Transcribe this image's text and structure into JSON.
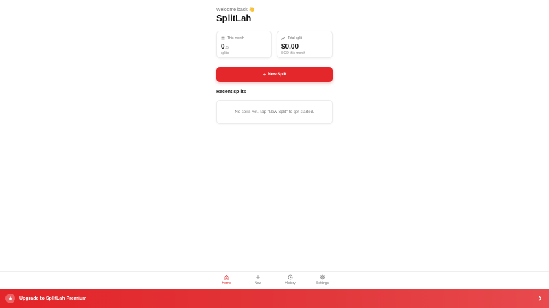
{
  "header": {
    "welcome": "Welcome back 👋",
    "title": "SplitLah"
  },
  "stats": {
    "month": {
      "label": "This month",
      "value": "0",
      "value_suffix": "/5",
      "caption": "splits",
      "icon": "calendar-icon"
    },
    "total": {
      "label": "Total split",
      "value": "$0.00",
      "caption": "SGD this month",
      "icon": "trend-up-icon"
    }
  },
  "new_split": {
    "label": "New Split",
    "icon": "plus-icon"
  },
  "recent": {
    "title": "Recent splits",
    "empty_text": "No splits yet. Tap \"New Split\" to get started."
  },
  "nav": {
    "items": [
      {
        "label": "Home",
        "icon": "home-icon",
        "active": true
      },
      {
        "label": "New",
        "icon": "plus-icon",
        "active": false
      },
      {
        "label": "History",
        "icon": "clock-icon",
        "active": false
      },
      {
        "label": "Settings",
        "icon": "gear-icon",
        "active": false
      }
    ]
  },
  "upgrade": {
    "label": "Upgrade to SplitLah Premium",
    "icon": "star-icon",
    "chevron": "chevron-right-icon"
  },
  "colors": {
    "accent": "#e3272b",
    "muted_text": "#777777",
    "card_border": "#ececec"
  }
}
